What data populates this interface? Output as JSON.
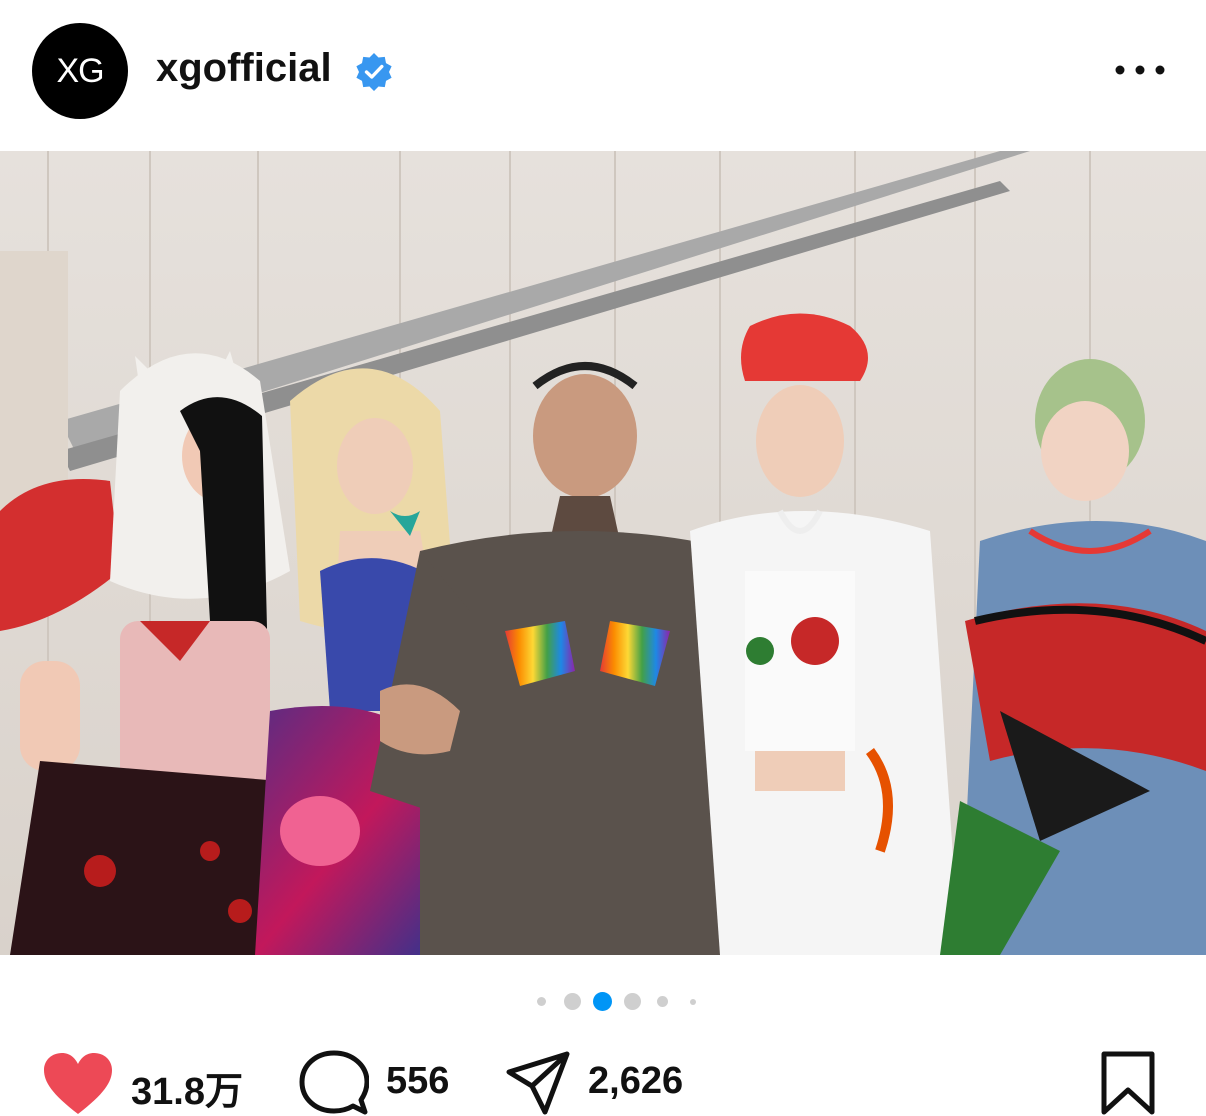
{
  "post": {
    "avatar_text": "XG",
    "username": "xgofficial",
    "verified": true,
    "icons": {
      "verified": "verified-badge-icon",
      "more": "more-options-icon",
      "like": "heart-icon",
      "comment": "comment-bubble-icon",
      "share": "paper-plane-icon",
      "save": "bookmark-icon"
    },
    "carousel": {
      "total": 6,
      "active": 3
    },
    "likes": "31.8万",
    "comments": "556",
    "shares": "2,626"
  },
  "colors": {
    "verified_blue": "#3897f0",
    "like_red": "#ed4956",
    "active_dot": "#0095f6",
    "inactive_dot": "#cfcfcf"
  }
}
